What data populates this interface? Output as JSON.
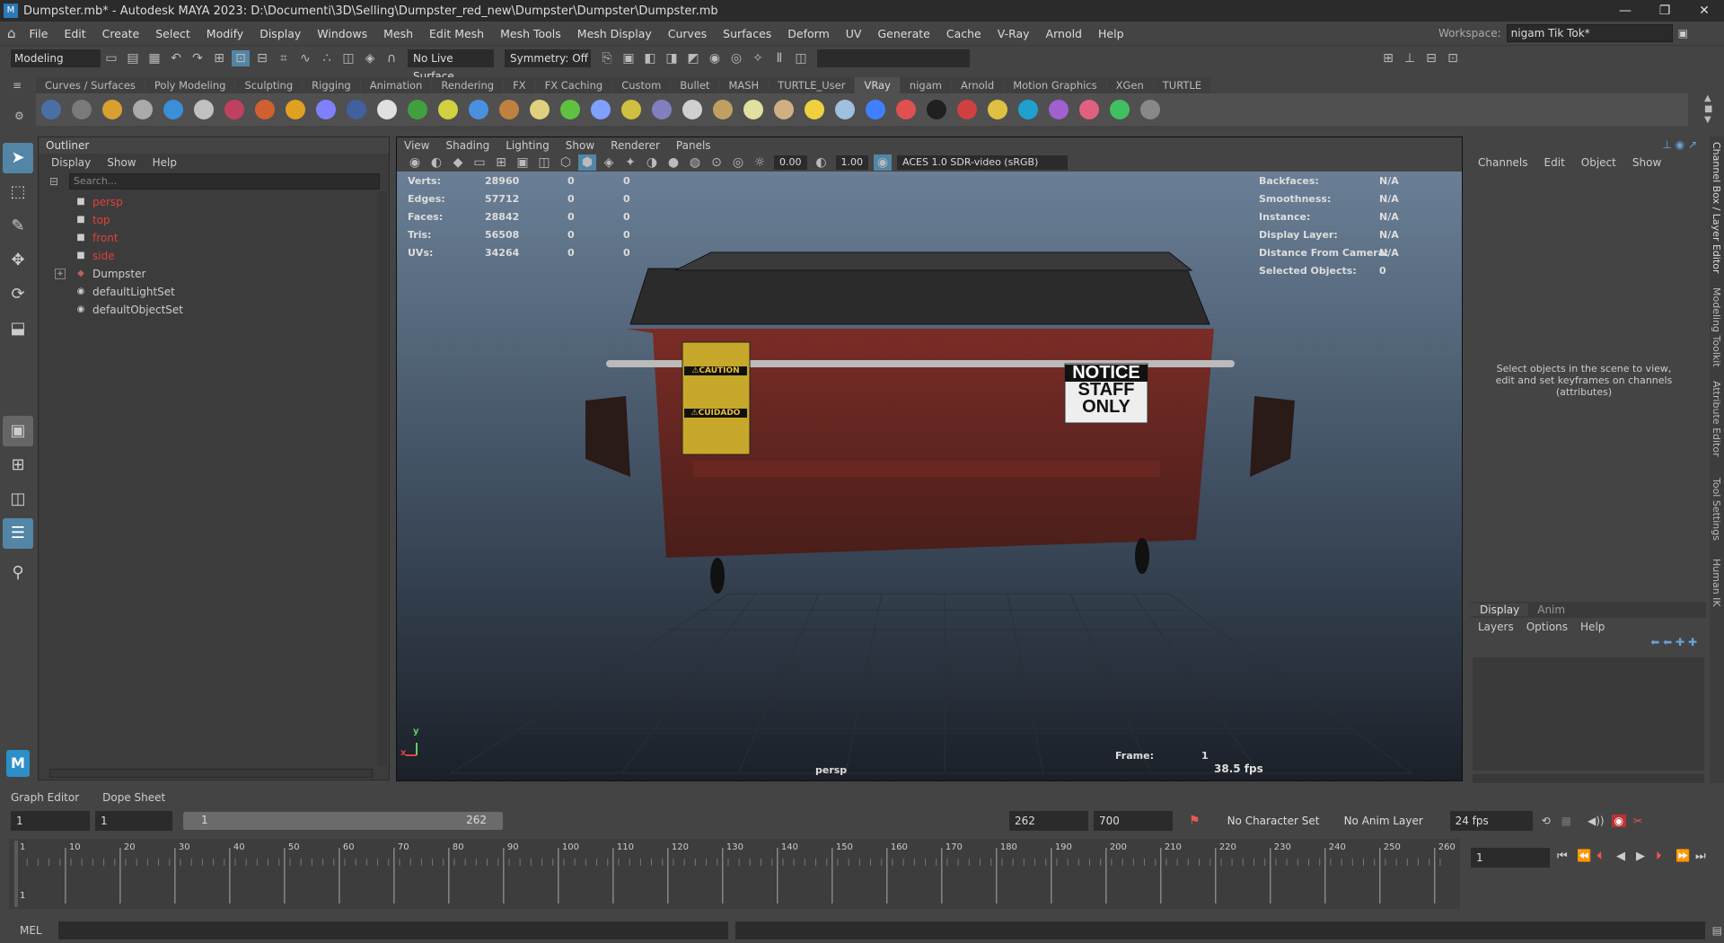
{
  "window": {
    "title": "Dumpster.mb* - Autodesk MAYA 2023: D:\\Documenti\\3D\\Selling\\Dumpster_red_new\\Dumpster\\Dumpster\\Dumpster.mb",
    "controls": [
      "—",
      "❐",
      "✕"
    ]
  },
  "menubar": [
    "File",
    "Edit",
    "Create",
    "Select",
    "Modify",
    "Display",
    "Windows",
    "Mesh",
    "Edit Mesh",
    "Mesh Tools",
    "Mesh Display",
    "Curves",
    "Surfaces",
    "Deform",
    "UV",
    "Generate",
    "Cache",
    "V-Ray",
    "Arnold",
    "Help"
  ],
  "workspace": {
    "label": "Workspace:",
    "value": "nigam Tik Tok*"
  },
  "statusline": {
    "mode": "Modeling",
    "live_surface": "No Live Surface",
    "symmetry": "Symmetry: Off"
  },
  "shelf": {
    "tabs": [
      "Curves / Surfaces",
      "Poly Modeling",
      "Sculpting",
      "Rigging",
      "Animation",
      "Rendering",
      "FX",
      "FX Caching",
      "Custom",
      "Bullet",
      "MASH",
      "TURTLE_User",
      "VRay",
      "nigam",
      "Arnold",
      "Motion Graphics",
      "XGen",
      "TURTLE"
    ],
    "active_tab": "VRay",
    "icons": [
      "vray-settings-icon",
      "vray-frame-buffer-icon",
      "vray-ipr-icon",
      "vray-light-icon",
      "vray-sphere-icon",
      "vray-dome-icon",
      "vray-camera-icon",
      "vray-material-icon",
      "vray-fire-icon",
      "vray-proxy-icon",
      "vray-cube-icon",
      "vray-plane-icon",
      "vray-mountain-icon",
      "vray-tool-icon",
      "vray-ball-icon",
      "vray-texture-icon",
      "vray-globe-icon",
      "vray-grass-icon",
      "vray-gear-icon",
      "vray-rope-icon",
      "vray-sphere2-icon",
      "vray-dome2-icon",
      "vray-lamp-icon",
      "vray-light2-icon",
      "vray-cone-icon",
      "vray-sun-icon",
      "vray-paper-icon",
      "vray-sphere3-icon",
      "vray-rings-icon",
      "vray-checker-icon",
      "vray-render-icon",
      "vray-bulb-icon",
      "vray-cloud-icon",
      "vray-ghost-icon",
      "vray-color-icon",
      "vray-arrows-icon",
      "help-icon"
    ]
  },
  "outliner": {
    "title": "Outliner",
    "menu": [
      "Display",
      "Show",
      "Help"
    ],
    "search_placeholder": "Search...",
    "items": [
      {
        "label": "persp",
        "color": "#e0403a",
        "icon": "camera-icon"
      },
      {
        "label": "top",
        "color": "#e0403a",
        "icon": "camera-icon"
      },
      {
        "label": "front",
        "color": "#e0403a",
        "icon": "camera-icon"
      },
      {
        "label": "side",
        "color": "#e0403a",
        "icon": "camera-icon"
      },
      {
        "label": "Dumpster",
        "color": "#cccccc",
        "icon": "mesh-icon"
      },
      {
        "label": "defaultLightSet",
        "color": "#cccccc",
        "icon": "set-icon"
      },
      {
        "label": "defaultObjectSet",
        "color": "#cccccc",
        "icon": "set-icon"
      }
    ]
  },
  "viewport": {
    "menu": [
      "View",
      "Shading",
      "Lighting",
      "Show",
      "Renderer",
      "Panels"
    ],
    "exposure": "0.00",
    "gamma": "1.00",
    "color_space": "ACES 1.0 SDR-video (sRGB)",
    "stats": [
      {
        "label": "Verts:",
        "v1": "28960",
        "v2": "0",
        "v3": "0"
      },
      {
        "label": "Edges:",
        "v1": "57712",
        "v2": "0",
        "v3": "0"
      },
      {
        "label": "Faces:",
        "v1": "28842",
        "v2": "0",
        "v3": "0"
      },
      {
        "label": "Tris:",
        "v1": "56508",
        "v2": "0",
        "v3": "0"
      },
      {
        "label": "UVs:",
        "v1": "34264",
        "v2": "0",
        "v3": "0"
      }
    ],
    "info": [
      {
        "label": "Backfaces:",
        "value": "N/A"
      },
      {
        "label": "Smoothness:",
        "value": "N/A"
      },
      {
        "label": "Instance:",
        "value": "N/A"
      },
      {
        "label": "Display Layer:",
        "value": "N/A"
      },
      {
        "label": "Distance From Camera:",
        "value": "N/A"
      },
      {
        "label": "Selected Objects:",
        "value": "0"
      }
    ],
    "frame_label": "Frame:",
    "frame_value": "1",
    "camera": "persp",
    "fps": "38.5 fps",
    "axis_x": "x",
    "axis_y": "y",
    "sign_notice": [
      "NOTICE",
      "STAFF",
      "ONLY"
    ],
    "sign_caution": "⚠CAUTION",
    "sign_cuidado": "⚠CUIDADO"
  },
  "channelbox": {
    "menu": [
      "Channels",
      "Edit",
      "Object",
      "Show"
    ],
    "message": "Select objects in the scene to view, edit and set keyframes on channels (attributes)"
  },
  "layereditor": {
    "tabs": [
      "Display",
      "Anim"
    ],
    "menu": [
      "Layers",
      "Options",
      "Help"
    ]
  },
  "sidetabs": [
    "Channel Box / Layer Editor",
    "Modeling Toolkit",
    "Attribute Editor",
    "Tool Settings",
    "Human IK"
  ],
  "lower_tabs": [
    "Graph Editor",
    "Dope Sheet"
  ],
  "range": {
    "start": "1",
    "start_inner": "1",
    "slider_start": "1",
    "slider_end": "262",
    "end_inner": "262",
    "end": "700",
    "character_set": "No Character Set",
    "anim_layer": "No Anim Layer",
    "fps": "24 fps"
  },
  "timeline": {
    "ticks": [
      "1",
      "10",
      "20",
      "30",
      "40",
      "50",
      "60",
      "70",
      "80",
      "90",
      "100",
      "110",
      "120",
      "130",
      "140",
      "150",
      "160",
      "170",
      "180",
      "190",
      "200",
      "210",
      "220",
      "230",
      "240",
      "250",
      "260"
    ],
    "current": "1"
  },
  "playback": {
    "current_frame": "1"
  },
  "mel": {
    "label": "MEL"
  }
}
